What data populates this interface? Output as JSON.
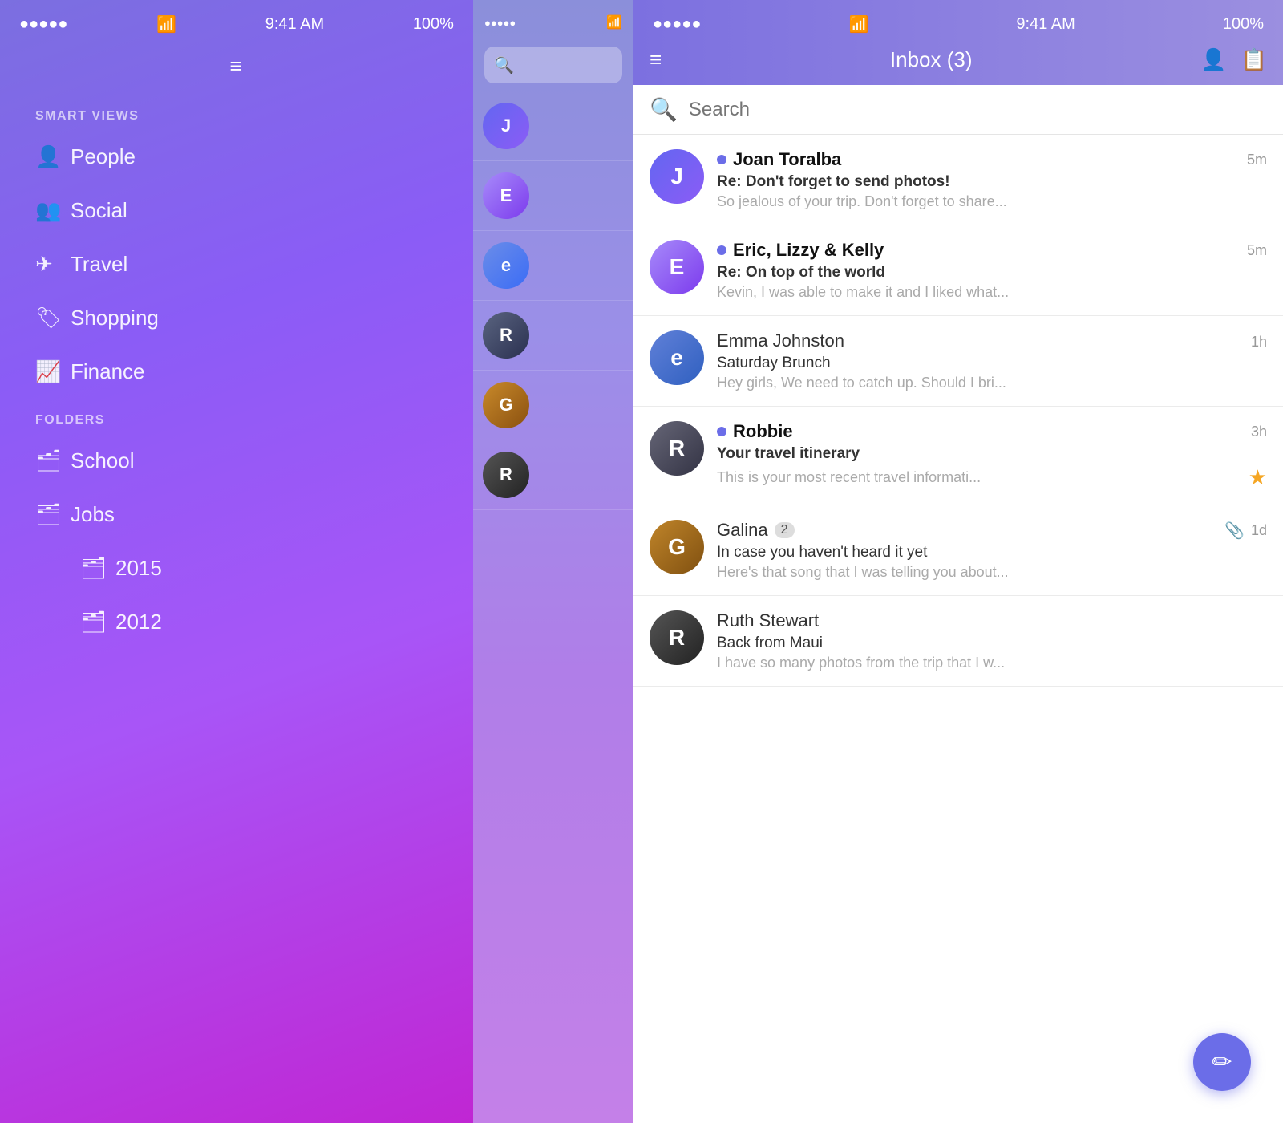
{
  "left": {
    "status": {
      "dots": "●●●●●",
      "wifi": "wifi",
      "time": "9:41 AM",
      "battery": "100%"
    },
    "hamburger_label": "≡",
    "smart_views_label": "SMART VIEWS",
    "nav_items": [
      {
        "id": "people",
        "icon": "person",
        "label": "People"
      },
      {
        "id": "social",
        "icon": "social",
        "label": "Social"
      },
      {
        "id": "travel",
        "icon": "travel",
        "label": "Travel"
      },
      {
        "id": "shopping",
        "icon": "shopping",
        "label": "Shopping"
      },
      {
        "id": "finance",
        "icon": "finance",
        "label": "Finance"
      }
    ],
    "folders_label": "FOLDERS",
    "folder_items": [
      {
        "id": "school",
        "icon": "folder",
        "label": "School"
      },
      {
        "id": "jobs",
        "icon": "folder",
        "label": "Jobs"
      },
      {
        "id": "2015",
        "icon": "folder",
        "label": "2015",
        "sub": true
      },
      {
        "id": "2012",
        "icon": "folder",
        "label": "2012",
        "sub": true
      }
    ]
  },
  "right": {
    "status": {
      "dots": "●●●●●",
      "wifi": "wifi",
      "time": "9:41 AM",
      "battery": "100%"
    },
    "nav": {
      "title": "Inbox (3)",
      "menu_label": "≡"
    },
    "search": {
      "placeholder": "Search"
    },
    "emails": [
      {
        "id": "joan",
        "sender": "Joan Toralba",
        "unread": true,
        "time": "5m",
        "subject": "Re: Don't forget to send photos!",
        "preview": "So jealous of your trip. Don't forget to share...",
        "avatar_letter": "J",
        "avatar_class": "av-joan",
        "starred": false,
        "has_attachment": false,
        "badge": null
      },
      {
        "id": "eric",
        "sender": "Eric, Lizzy & Kelly",
        "unread": true,
        "time": "5m",
        "subject": "Re: On top of the world",
        "preview": "Kevin, I was able to make it and I liked what...",
        "avatar_letter": "E",
        "avatar_class": "av-eric",
        "starred": false,
        "has_attachment": false,
        "badge": null
      },
      {
        "id": "emma",
        "sender": "Emma Johnston",
        "unread": false,
        "time": "1h",
        "subject": "Saturday Brunch",
        "preview": "Hey girls, We need to catch up. Should I bri...",
        "avatar_letter": "e",
        "avatar_class": "av-emma",
        "starred": false,
        "has_attachment": false,
        "badge": null
      },
      {
        "id": "robbie",
        "sender": "Robbie",
        "unread": true,
        "time": "3h",
        "subject": "Your travel itinerary",
        "preview": "This is your most recent travel informati...",
        "avatar_letter": "R",
        "avatar_class": "av-robbie",
        "starred": true,
        "has_attachment": false,
        "badge": null
      },
      {
        "id": "galina",
        "sender": "Galina",
        "unread": false,
        "time": "1d",
        "subject": "In case you haven't heard it yet",
        "preview": "Here's that song that I was telling you about...",
        "avatar_letter": "G",
        "avatar_class": "av-galina",
        "starred": false,
        "has_attachment": true,
        "badge": "2"
      },
      {
        "id": "ruth",
        "sender": "Ruth Stewart",
        "unread": false,
        "time": "",
        "subject": "Back from Maui",
        "preview": "I have so many photos from the trip that I w...",
        "avatar_letter": "R",
        "avatar_class": "av-ruth",
        "starred": false,
        "has_attachment": false,
        "badge": null
      }
    ],
    "compose_label": "✏"
  }
}
